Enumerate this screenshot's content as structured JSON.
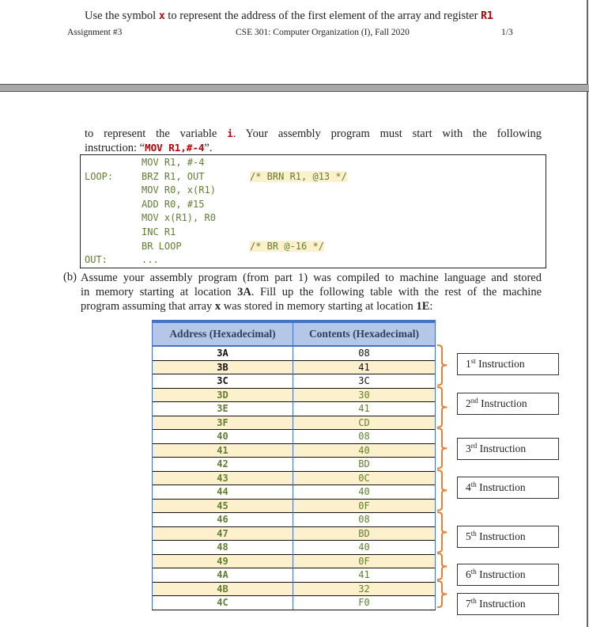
{
  "prev_page": {
    "note_prefix": "Use the symbol ",
    "note_x": "x",
    "note_middle": " to represent the address of the first element of the array and register ",
    "note_r1": "R1",
    "header_left": "Assignment #3",
    "header_center": "CSE 301: Computer Organization (I), Fall 2020",
    "header_right": "1/3"
  },
  "intro": {
    "line1_prefix": "to represent the variable ",
    "line1_var": "i",
    "line1_suffix": ". Your assembly program must start with the following",
    "line2_prefix": "instruction: “",
    "line2_code": "MOV R1,#-4",
    "line2_suffix": "”."
  },
  "code": {
    "lines": [
      {
        "label": "",
        "instr": "MOV R1, #-4",
        "comment": ""
      },
      {
        "label": "LOOP:",
        "instr": "BRZ R1, OUT",
        "comment": "/* BRN R1, @13 */"
      },
      {
        "label": "",
        "instr": "MOV R0, x(R1)",
        "comment": ""
      },
      {
        "label": "",
        "instr": "ADD R0, #15",
        "comment": ""
      },
      {
        "label": "",
        "instr": "MOV x(R1), R0",
        "comment": ""
      },
      {
        "label": "",
        "instr": "INC R1",
        "comment": ""
      },
      {
        "label": "",
        "instr": "BR LOOP",
        "comment": "/* BR @-16 */"
      },
      {
        "label": "OUT:",
        "instr": "...",
        "comment": ""
      }
    ]
  },
  "part_b": {
    "label": "(b)",
    "line1": "Assume your assembly program (from part 1) was compiled to machine language and stored",
    "line2_prefix": "in memory starting at location ",
    "line2_loc": "3A",
    "line2_suffix": ". Fill up the following table with the rest of the machine",
    "line3_prefix": "program assuming that array ",
    "line3_x": "x",
    "line3_middle": " was stored in memory starting at location ",
    "line3_loc": "1E",
    "line3_suffix": ":"
  },
  "table": {
    "headers": [
      "Address (Hexadecimal)",
      "Contents (Hexadecimal)"
    ],
    "rows": [
      {
        "address": "3A",
        "contents": "08",
        "given": true
      },
      {
        "address": "3B",
        "contents": "41",
        "given": true
      },
      {
        "address": "3C",
        "contents": "3C",
        "given": true
      },
      {
        "address": "3D",
        "contents": "30",
        "given": false
      },
      {
        "address": "3E",
        "contents": "41",
        "given": false
      },
      {
        "address": "3F",
        "contents": "CD",
        "given": false
      },
      {
        "address": "40",
        "contents": "08",
        "given": false
      },
      {
        "address": "41",
        "contents": "40",
        "given": false
      },
      {
        "address": "42",
        "contents": "BD",
        "given": false
      },
      {
        "address": "43",
        "contents": "0C",
        "given": false
      },
      {
        "address": "44",
        "contents": "40",
        "given": false
      },
      {
        "address": "45",
        "contents": "0F",
        "given": false
      },
      {
        "address": "46",
        "contents": "08",
        "given": false
      },
      {
        "address": "47",
        "contents": "BD",
        "given": false
      },
      {
        "address": "48",
        "contents": "40",
        "given": false
      },
      {
        "address": "49",
        "contents": "0F",
        "given": false
      },
      {
        "address": "4A",
        "contents": "41",
        "given": false
      },
      {
        "address": "4B",
        "contents": "32",
        "given": false
      },
      {
        "address": "4C",
        "contents": "F0",
        "given": false
      }
    ]
  },
  "instructions": [
    {
      "num": "1",
      "suffix": "st",
      "label": " Instruction",
      "rows": 3
    },
    {
      "num": "2",
      "suffix": "nd",
      "label": " Instruction",
      "rows": 3
    },
    {
      "num": "3",
      "suffix": "rd",
      "label": " Instruction",
      "rows": 3
    },
    {
      "num": "4",
      "suffix": "th",
      "label": " Instruction",
      "rows": 3
    },
    {
      "num": "5",
      "suffix": "th",
      "label": " Instruction",
      "rows": 3
    },
    {
      "num": "6",
      "suffix": "th",
      "label": " Instruction",
      "rows": 2
    },
    {
      "num": "7",
      "suffix": "th",
      "label": " Instruction",
      "rows": 2
    }
  ],
  "colors": {
    "accent_red": "#c00000",
    "code_green": "#5f7f2e",
    "header_blue": "#b4c7e7",
    "border_blue": "#4472c4",
    "row_highlight": "#fdf0cc",
    "bracket_orange": "#ed7d31"
  }
}
